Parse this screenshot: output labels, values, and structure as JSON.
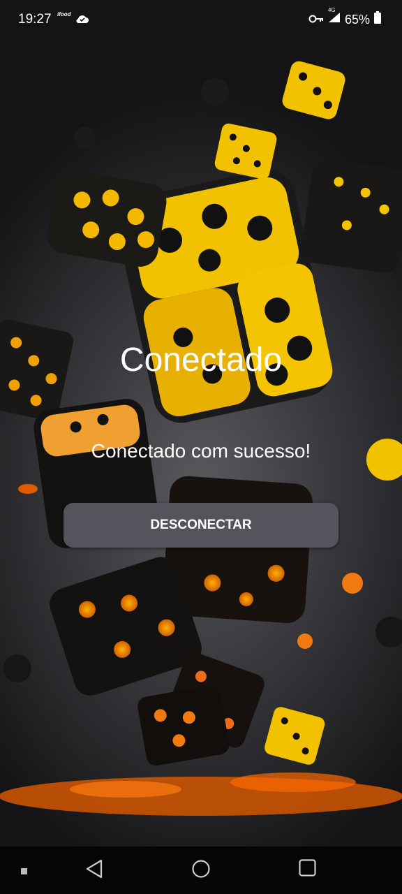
{
  "status_bar": {
    "time": "19:27",
    "ifood_label": "ifood",
    "network": "4G",
    "battery": "65%"
  },
  "main": {
    "title": "Conectado",
    "message": "Conectado com sucesso!",
    "disconnect_label": "DESCONECTAR"
  },
  "nav_bar": {
    "icons": [
      "recents-dot-icon",
      "back-icon",
      "home-icon",
      "overview-icon"
    ]
  },
  "colors": {
    "button_bg": "#55545c",
    "accent_yellow": "#f5b800",
    "accent_orange": "#f06a00"
  }
}
